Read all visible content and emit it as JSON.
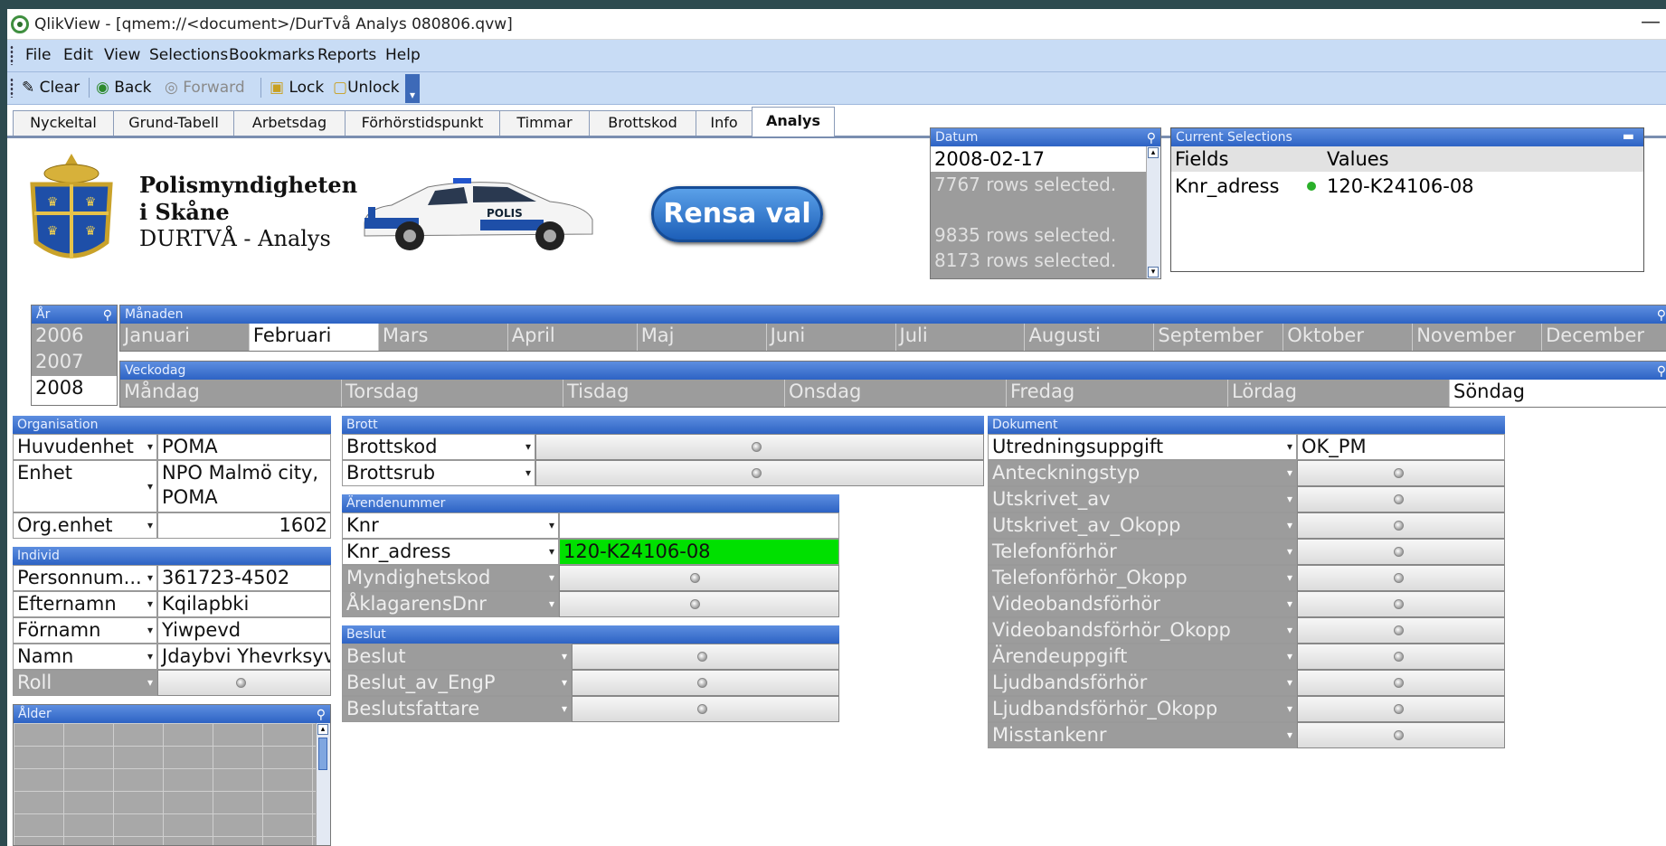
{
  "window": {
    "title": "QlikView - [qmem://<document>/DurTvå Analys  080806.qvw]",
    "minimize": "—"
  },
  "menu": [
    "File",
    "Edit",
    "View",
    "Selections",
    "Bookmarks",
    "Reports",
    "Help"
  ],
  "toolbar": {
    "clear": "Clear",
    "back": "Back",
    "forward": "Forward",
    "lock": "Lock",
    "unlock": "Unlock"
  },
  "tabs": [
    "Nyckeltal",
    "Grund-Tabell",
    "Arbetsdag",
    "Förhörstidspunkt",
    "Timmar",
    "Brottskod",
    "Info",
    "Analys"
  ],
  "active_tab": "Analys",
  "logo": {
    "line1": "Polismyndigheten",
    "line2": "i Skåne",
    "line3": "DURTVÅ - Analys",
    "car_text": "POLIS"
  },
  "rensa_button": "Rensa val",
  "datum": {
    "title": "Datum",
    "items": [
      "2008-02-17",
      "7767 rows selected.",
      "",
      "9835 rows selected.",
      "8173 rows selected."
    ]
  },
  "current_selections": {
    "title": "Current Selections",
    "fields_header": "Fields",
    "values_header": "Values",
    "rows": [
      {
        "field": "Knr_adress",
        "value": "120-K24106-08"
      }
    ]
  },
  "ar": {
    "title": "År",
    "items": [
      "2006",
      "2007",
      "2008"
    ],
    "selected": "2008"
  },
  "manaden": {
    "title": "Månaden",
    "items": [
      "Januari",
      "Februari",
      "Mars",
      "April",
      "Maj",
      "Juni",
      "Juli",
      "Augusti",
      "September",
      "Oktober",
      "November",
      "December"
    ],
    "selected": "Februari"
  },
  "veckodag": {
    "title": "Veckodag",
    "items": [
      "Måndag",
      "Torsdag",
      "Tisdag",
      "Onsdag",
      "Fredag",
      "Lördag",
      "Söndag"
    ],
    "selected": "Söndag"
  },
  "organisation": {
    "title": "Organisation",
    "rows": [
      {
        "label": "Huvudenhet",
        "value": "POMA"
      },
      {
        "label": "Enhet",
        "value": "NPO Malmö city,",
        "value2": "POMA"
      },
      {
        "label": "Org.enhet",
        "value": "1602"
      }
    ]
  },
  "individ": {
    "title": "Individ",
    "rows": [
      {
        "label": "Personnum...",
        "value": "361723-4502"
      },
      {
        "label": "Efternamn",
        "value": "Kqilapbki"
      },
      {
        "label": "Förnamn",
        "value": "Yiwpevd"
      },
      {
        "label": "Namn",
        "value": "Jdaybvi Yhevrksyv"
      },
      {
        "label": "Roll",
        "value": ""
      }
    ]
  },
  "alder": {
    "title": "Ålder"
  },
  "brott": {
    "title": "Brott",
    "rows": [
      {
        "label": "Brottskod"
      },
      {
        "label": "Brottsrub"
      }
    ]
  },
  "arendenummer": {
    "title": "Ärendenummer",
    "rows": [
      {
        "label": "Knr",
        "value": ""
      },
      {
        "label": "Knr_adress",
        "value": "120-K24106-08"
      },
      {
        "label": "Myndighetskod",
        "value": ""
      },
      {
        "label": "ÅklagarensDnr",
        "value": ""
      }
    ]
  },
  "beslut": {
    "title": "Beslut",
    "rows": [
      {
        "label": "Beslut"
      },
      {
        "label": "Beslut_av_EngP"
      },
      {
        "label": "Beslutsfattare"
      }
    ]
  },
  "dokument": {
    "title": "Dokument",
    "rows": [
      {
        "label": "Utredningsuppgift",
        "value": "OK_PM"
      },
      {
        "label": "Anteckningstyp"
      },
      {
        "label": "Utskrivet_av"
      },
      {
        "label": "Utskrivet_av_Okopp"
      },
      {
        "label": "Telefonförhör"
      },
      {
        "label": "Telefonförhör_Okopp"
      },
      {
        "label": "Videobandsförhör"
      },
      {
        "label": "Videobandsförhör_Okopp"
      },
      {
        "label": "Ärendeuppgift"
      },
      {
        "label": "Ljudbandsförhör"
      },
      {
        "label": "Ljudbandsförhör_Okopp"
      },
      {
        "label": "Misstankenr"
      }
    ]
  },
  "colors": {
    "selected": "#ffffff",
    "excluded": "#9c9c9c",
    "possible_green": "#00e000",
    "header_blue": "#2d63c4"
  }
}
